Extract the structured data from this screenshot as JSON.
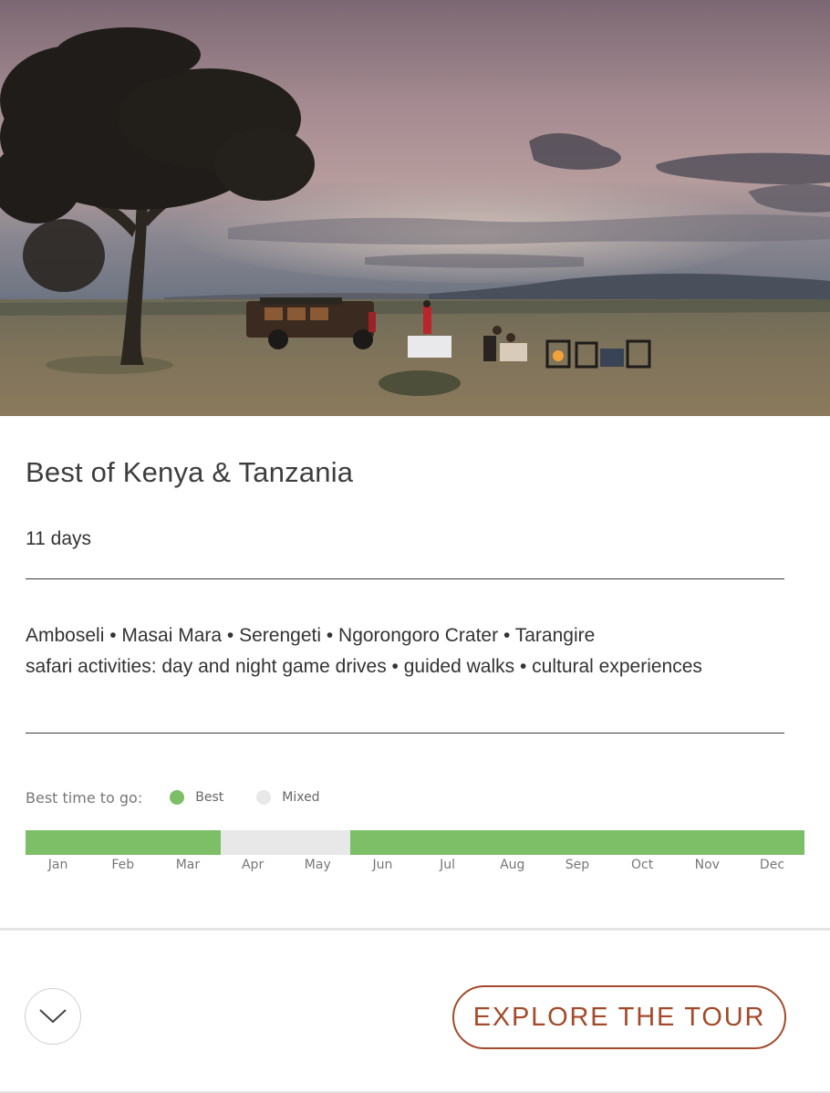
{
  "tour": {
    "title": "Best of Kenya & Tanzania",
    "duration": "11 days",
    "destinations": "Amboseli • Masai Mara • Serengeti • Ngorongoro Crater • Tarangire",
    "activities": "safari activities: day and night game drives • guided walks • cultural experiences"
  },
  "best_time": {
    "label": "Best time to go:",
    "legend": [
      {
        "name": "Best",
        "color": "#7cbf67"
      },
      {
        "name": "Mixed",
        "color": "#e8e8e8"
      }
    ],
    "months": [
      {
        "name": "Jan",
        "rating": "Best"
      },
      {
        "name": "Feb",
        "rating": "Best"
      },
      {
        "name": "Mar",
        "rating": "Best"
      },
      {
        "name": "Apr",
        "rating": "Mixed"
      },
      {
        "name": "May",
        "rating": "Mixed"
      },
      {
        "name": "Jun",
        "rating": "Best"
      },
      {
        "name": "Jul",
        "rating": "Best"
      },
      {
        "name": "Aug",
        "rating": "Best"
      },
      {
        "name": "Sep",
        "rating": "Best"
      },
      {
        "name": "Oct",
        "rating": "Best"
      },
      {
        "name": "Nov",
        "rating": "Best"
      },
      {
        "name": "Dec",
        "rating": "Best"
      }
    ]
  },
  "actions": {
    "expand_icon": "chevron-down-icon",
    "explore_label": "EXPLORE THE TOUR"
  },
  "colors": {
    "accent": "#a34a2a",
    "best": "#7cbf67",
    "mixed": "#e8e8e8"
  },
  "hero_image": {
    "subject": "safari-sunset-landscape"
  }
}
